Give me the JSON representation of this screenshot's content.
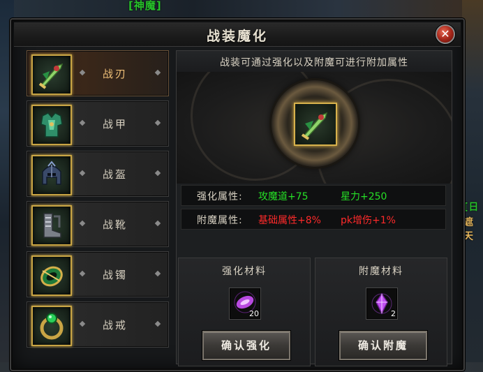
{
  "background": {
    "top_tag": "[神魔]",
    "right_tag_1": "[日",
    "right_tag_2": "遮天"
  },
  "window": {
    "title": "战装魔化",
    "close_icon": "close-x-icon"
  },
  "sidebar": {
    "items": [
      {
        "label": "战刃",
        "icon": "blade-icon",
        "active": true
      },
      {
        "label": "战甲",
        "icon": "armor-icon",
        "active": false
      },
      {
        "label": "战盔",
        "icon": "helmet-icon",
        "active": false
      },
      {
        "label": "战靴",
        "icon": "boots-icon",
        "active": false
      },
      {
        "label": "战镯",
        "icon": "bracelet-icon",
        "active": false
      },
      {
        "label": "战戒",
        "icon": "ring-icon",
        "active": false
      }
    ]
  },
  "panel": {
    "description": "战装可通过强化以及附魔可进行附加属性",
    "selected_item_icon": "blade-icon",
    "enhance": {
      "label": "强化属性:",
      "value1": "攻魔道+75",
      "value2": "星力+250"
    },
    "enchant": {
      "label": "附魔属性:",
      "value1": "基础属性+8%",
      "value2": "pk增伤+1%"
    },
    "enhance_materials": {
      "title": "强化材料",
      "icon": "purple-crystal-icon",
      "count": "20",
      "button_label": "确认强化"
    },
    "enchant_materials": {
      "title": "附魔材料",
      "icon": "purple-gem-icon",
      "count": "2",
      "button_label": "确认附魔"
    }
  },
  "colors": {
    "green_value": "#26e026",
    "red_value": "#ff2a2a",
    "gold_border": "#c9a545"
  }
}
